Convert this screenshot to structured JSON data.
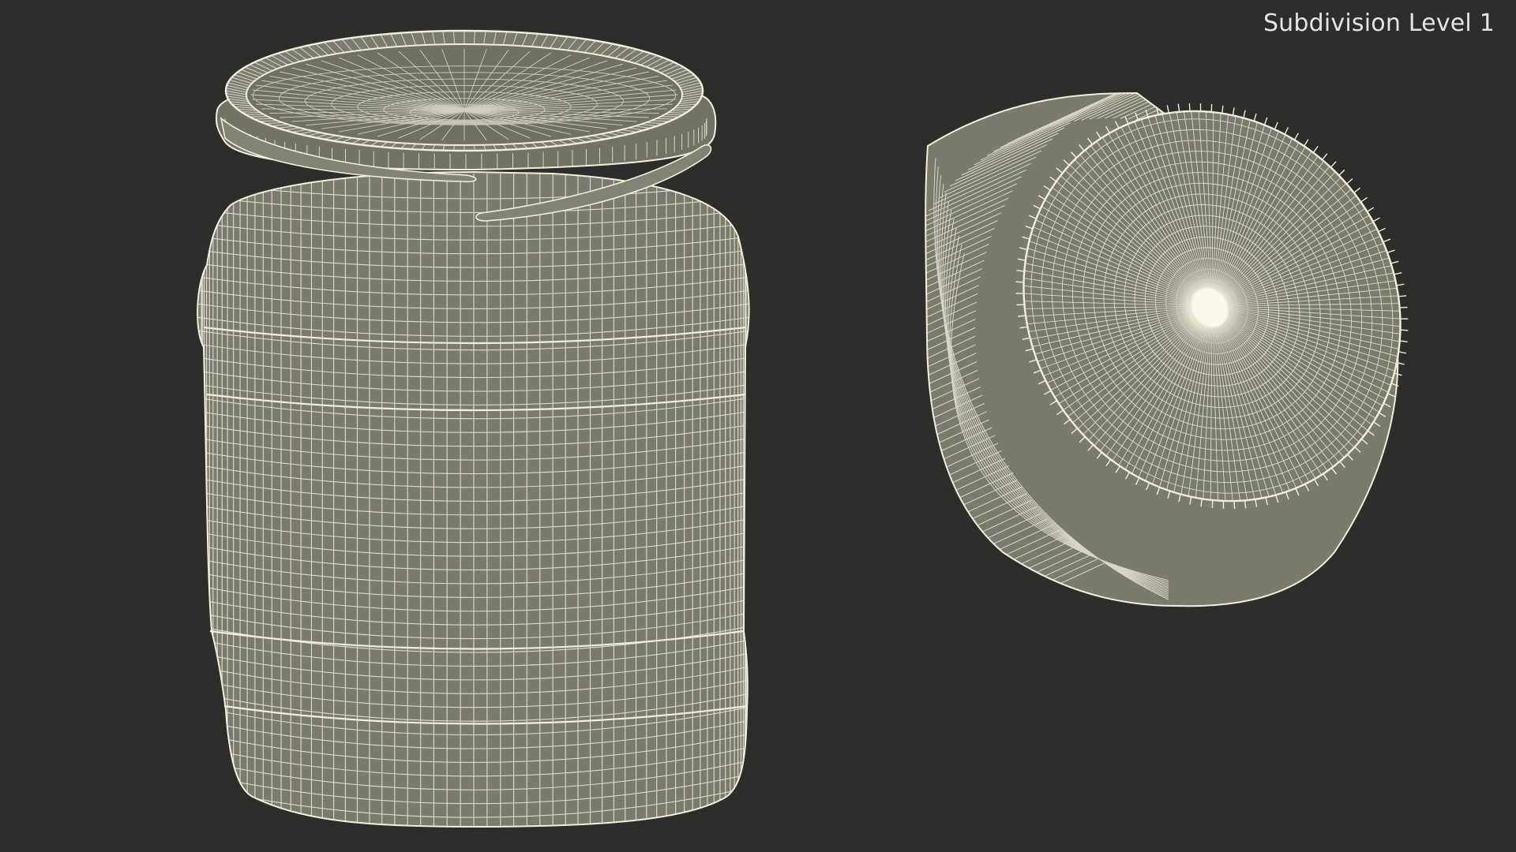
{
  "viewport": {
    "label": "Subdivision Level 1"
  },
  "colors": {
    "background": "#2d2d2c",
    "surface": "#7b7b6d",
    "surface_dark": "#6b6b60",
    "wire": "#f1eedd",
    "label": "#e4e4e4"
  },
  "objects": [
    {
      "name": "jar",
      "shading": "wireframe-on-shaded"
    },
    {
      "name": "lid",
      "shading": "wireframe-on-shaded"
    }
  ]
}
